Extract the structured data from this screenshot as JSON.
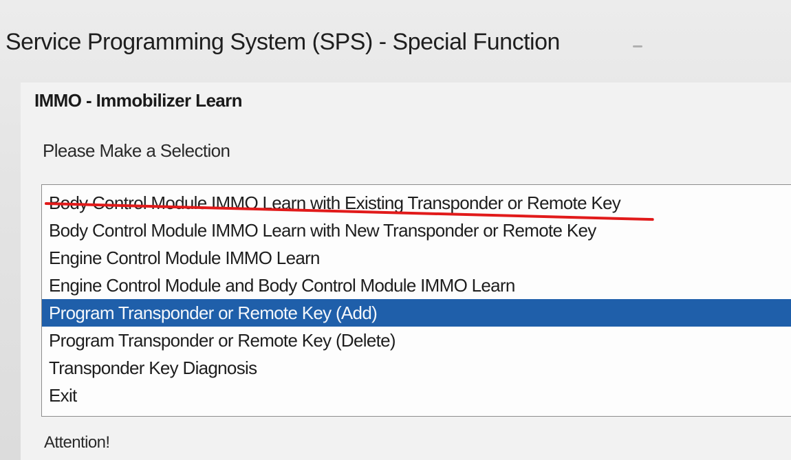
{
  "window": {
    "title": "Service Programming System (SPS) - Special Function"
  },
  "panel": {
    "title": "IMMO - Immobilizer Learn",
    "prompt": "Please Make a Selection",
    "attention": "Attention!"
  },
  "selection_list": {
    "selected_index": 4,
    "struck_through_index": 0,
    "strike_color": "#e11a1a",
    "selection_color": "#1f5faa",
    "items": [
      {
        "label": "Body Control Module IMMO Learn with Existing Transponder or Remote Key"
      },
      {
        "label": "Body Control Module IMMO Learn with New Transponder or Remote Key"
      },
      {
        "label": "Engine Control Module IMMO Learn"
      },
      {
        "label": "Engine Control Module and Body Control Module IMMO Learn"
      },
      {
        "label": "Program Transponder or Remote Key (Add)"
      },
      {
        "label": "Program Transponder or Remote Key (Delete)"
      },
      {
        "label": "Transponder Key Diagnosis"
      },
      {
        "label": "Exit"
      }
    ]
  }
}
